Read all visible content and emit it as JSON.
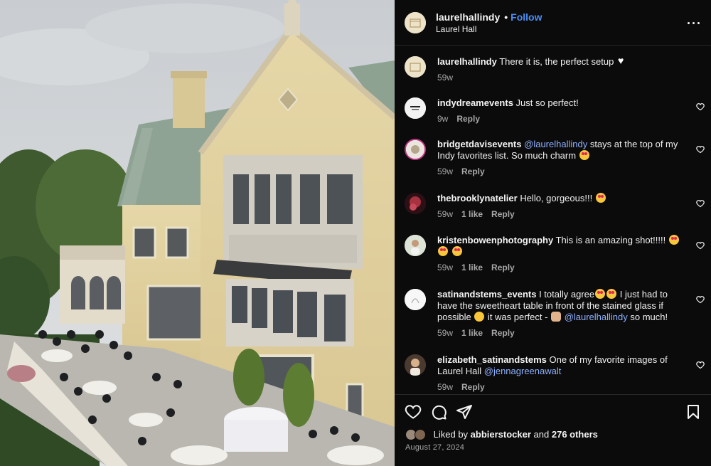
{
  "post": {
    "username": "laurelhallindy",
    "separator": "•",
    "follow_label": "Follow",
    "location": "Laurel Hall",
    "more_icon": "more-horizontal-icon"
  },
  "caption": {
    "username": "laurelhallindy",
    "text": " There it is, the perfect setup ",
    "time": "59w"
  },
  "comments": [
    {
      "username": "indydreamevents",
      "text": " Just so perfect!",
      "time": "9w",
      "likes": "",
      "reply": "Reply"
    },
    {
      "username": "bridgetdavisevents",
      "pre": " ",
      "mention": "@laurelhallindy",
      "text": " stays at the top of my Indy favorites list. So much charm ",
      "time": "59w",
      "likes": "",
      "reply": "Reply"
    },
    {
      "username": "thebrooklynatelier",
      "text": " Hello, gorgeous!!! ",
      "time": "59w",
      "likes": "1 like",
      "reply": "Reply"
    },
    {
      "username": "kristenbowenphotography",
      "text": " This is an amazing shot!!!!! ",
      "time": "59w",
      "likes": "1 like",
      "reply": "Reply"
    },
    {
      "username": "satinandstems_events",
      "text_a": " I totally agree",
      "text_b": " I just had to have the sweetheart table in front of the stained glass if possible ",
      "text_c": " it was perfect - ",
      "mention": "@laurelhallindy",
      "text_d": " so much!",
      "time": "59w",
      "likes": "1 like",
      "reply": "Reply"
    },
    {
      "username": "elizabeth_satinandstems",
      "text": " One of my favorite images of Laurel Hall ",
      "mention": "@jennagreenawalt",
      "time": "59w",
      "likes": "",
      "reply": "Reply"
    }
  ],
  "actions": {
    "like_icon": "heart-icon",
    "comment_icon": "comment-icon",
    "share_icon": "share-icon",
    "save_icon": "bookmark-icon"
  },
  "likes": {
    "prefix": "Liked by ",
    "user": "abbierstocker",
    "middle": " and ",
    "count": "276 others"
  },
  "date": "August 27, 2024",
  "colors": {
    "link": "#4a8ff7",
    "mention": "#8fb0ff",
    "background": "#000000"
  }
}
